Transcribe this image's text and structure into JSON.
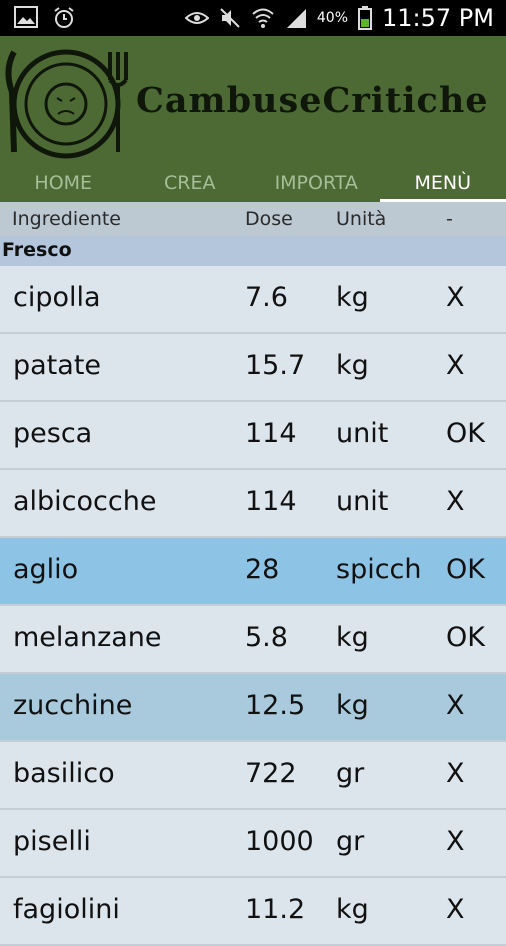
{
  "status_bar": {
    "battery_percent": "40%",
    "time": "11:57 PM",
    "left_icons": [
      "image-icon",
      "alarm-icon"
    ],
    "right_icons": [
      "eye-icon",
      "mute-icon",
      "wifi-icon",
      "signal-icon",
      "battery-icon"
    ]
  },
  "app": {
    "title": "CambuseCritiche",
    "colors": {
      "appbar": "#4d6a35",
      "highlight": "#8dc4e6",
      "selected": "#a9cadd"
    }
  },
  "tabs": [
    {
      "label": "HOME",
      "active": false
    },
    {
      "label": "CREA",
      "active": false
    },
    {
      "label": "IMPORTA",
      "active": false
    },
    {
      "label": "MENÙ",
      "active": true
    }
  ],
  "table": {
    "headers": [
      "Ingrediente",
      "Dose",
      "Unità",
      "-"
    ],
    "section": "Fresco",
    "rows": [
      {
        "name": "cipolla",
        "dose": "7.6",
        "unit": "kg",
        "status": "X"
      },
      {
        "name": "patate",
        "dose": "15.7",
        "unit": "kg",
        "status": "X"
      },
      {
        "name": "pesca",
        "dose": "114",
        "unit": "unit",
        "status": "OK"
      },
      {
        "name": "albicocche",
        "dose": "114",
        "unit": "unit",
        "status": "X"
      },
      {
        "name": "aglio",
        "dose": "28",
        "unit": "spicch",
        "status": "OK"
      },
      {
        "name": "melanzane",
        "dose": "5.8",
        "unit": "kg",
        "status": "OK"
      },
      {
        "name": "zucchine",
        "dose": "12.5",
        "unit": "kg",
        "status": "X"
      },
      {
        "name": "basilico",
        "dose": "722",
        "unit": "gr",
        "status": "X"
      },
      {
        "name": "piselli",
        "dose": "1000",
        "unit": "gr",
        "status": "X"
      },
      {
        "name": "fagiolini",
        "dose": "11.2",
        "unit": "kg",
        "status": "X"
      }
    ]
  }
}
